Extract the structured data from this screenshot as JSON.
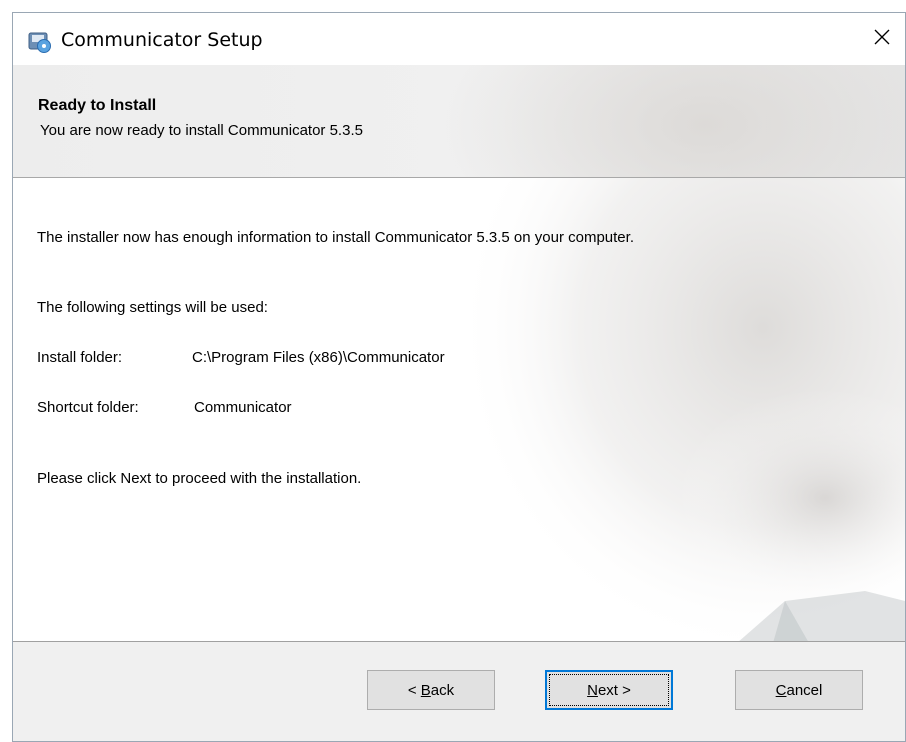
{
  "window": {
    "title": "Communicator Setup",
    "icon": "installer-disk-icon",
    "close_icon": "close-icon"
  },
  "header": {
    "title": "Ready to Install",
    "subtitle": "You are now ready to install Communicator 5.3.5"
  },
  "content": {
    "intro": "The installer now has enough information to install Communicator 5.3.5 on your computer.",
    "settings_heading": "The following settings will be used:",
    "install_folder_label": "Install folder:",
    "install_folder_value": "C:\\Program Files (x86)\\Communicator",
    "shortcut_folder_label": "Shortcut folder:",
    "shortcut_folder_value": "Communicator",
    "instruction": "Please click Next to proceed with the installation."
  },
  "buttons": {
    "back": {
      "prefix": "< ",
      "mnemonic": "B",
      "rest": "ack"
    },
    "next": {
      "mnemonic": "N",
      "rest": "ext >"
    },
    "cancel": {
      "mnemonic": "C",
      "rest": "ancel"
    }
  },
  "colors": {
    "focus_border": "#0078d7",
    "footer_bg": "#f0f0f0",
    "button_bg": "#e1e1e1"
  }
}
